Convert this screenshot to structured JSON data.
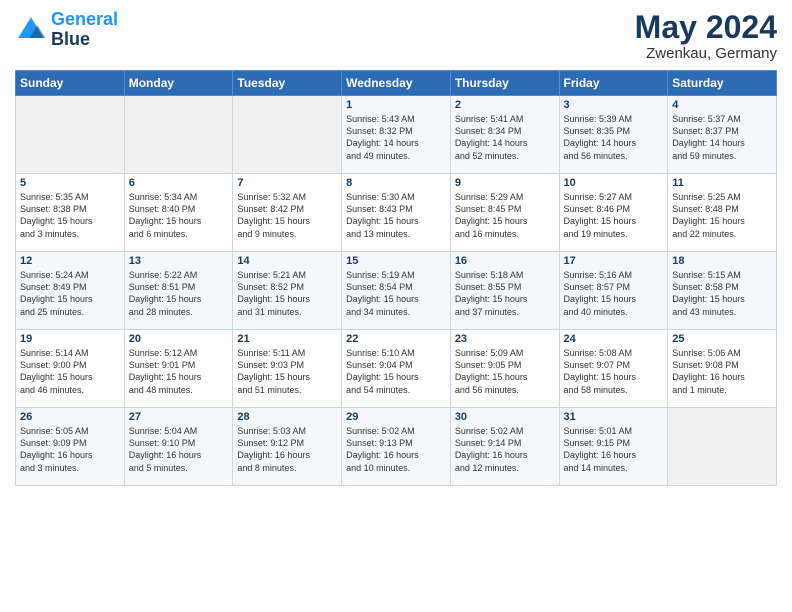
{
  "header": {
    "logo_line1": "General",
    "logo_line2": "Blue",
    "title": "May 2024",
    "subtitle": "Zwenkau, Germany"
  },
  "days_of_week": [
    "Sunday",
    "Monday",
    "Tuesday",
    "Wednesday",
    "Thursday",
    "Friday",
    "Saturday"
  ],
  "weeks": [
    [
      {
        "day": "",
        "info": ""
      },
      {
        "day": "",
        "info": ""
      },
      {
        "day": "",
        "info": ""
      },
      {
        "day": "1",
        "info": "Sunrise: 5:43 AM\nSunset: 8:32 PM\nDaylight: 14 hours\nand 49 minutes."
      },
      {
        "day": "2",
        "info": "Sunrise: 5:41 AM\nSunset: 8:34 PM\nDaylight: 14 hours\nand 52 minutes."
      },
      {
        "day": "3",
        "info": "Sunrise: 5:39 AM\nSunset: 8:35 PM\nDaylight: 14 hours\nand 56 minutes."
      },
      {
        "day": "4",
        "info": "Sunrise: 5:37 AM\nSunset: 8:37 PM\nDaylight: 14 hours\nand 59 minutes."
      }
    ],
    [
      {
        "day": "5",
        "info": "Sunrise: 5:35 AM\nSunset: 8:38 PM\nDaylight: 15 hours\nand 3 minutes."
      },
      {
        "day": "6",
        "info": "Sunrise: 5:34 AM\nSunset: 8:40 PM\nDaylight: 15 hours\nand 6 minutes."
      },
      {
        "day": "7",
        "info": "Sunrise: 5:32 AM\nSunset: 8:42 PM\nDaylight: 15 hours\nand 9 minutes."
      },
      {
        "day": "8",
        "info": "Sunrise: 5:30 AM\nSunset: 8:43 PM\nDaylight: 15 hours\nand 13 minutes."
      },
      {
        "day": "9",
        "info": "Sunrise: 5:29 AM\nSunset: 8:45 PM\nDaylight: 15 hours\nand 16 minutes."
      },
      {
        "day": "10",
        "info": "Sunrise: 5:27 AM\nSunset: 8:46 PM\nDaylight: 15 hours\nand 19 minutes."
      },
      {
        "day": "11",
        "info": "Sunrise: 5:25 AM\nSunset: 8:48 PM\nDaylight: 15 hours\nand 22 minutes."
      }
    ],
    [
      {
        "day": "12",
        "info": "Sunrise: 5:24 AM\nSunset: 8:49 PM\nDaylight: 15 hours\nand 25 minutes."
      },
      {
        "day": "13",
        "info": "Sunrise: 5:22 AM\nSunset: 8:51 PM\nDaylight: 15 hours\nand 28 minutes."
      },
      {
        "day": "14",
        "info": "Sunrise: 5:21 AM\nSunset: 8:52 PM\nDaylight: 15 hours\nand 31 minutes."
      },
      {
        "day": "15",
        "info": "Sunrise: 5:19 AM\nSunset: 8:54 PM\nDaylight: 15 hours\nand 34 minutes."
      },
      {
        "day": "16",
        "info": "Sunrise: 5:18 AM\nSunset: 8:55 PM\nDaylight: 15 hours\nand 37 minutes."
      },
      {
        "day": "17",
        "info": "Sunrise: 5:16 AM\nSunset: 8:57 PM\nDaylight: 15 hours\nand 40 minutes."
      },
      {
        "day": "18",
        "info": "Sunrise: 5:15 AM\nSunset: 8:58 PM\nDaylight: 15 hours\nand 43 minutes."
      }
    ],
    [
      {
        "day": "19",
        "info": "Sunrise: 5:14 AM\nSunset: 9:00 PM\nDaylight: 15 hours\nand 46 minutes."
      },
      {
        "day": "20",
        "info": "Sunrise: 5:12 AM\nSunset: 9:01 PM\nDaylight: 15 hours\nand 48 minutes."
      },
      {
        "day": "21",
        "info": "Sunrise: 5:11 AM\nSunset: 9:03 PM\nDaylight: 15 hours\nand 51 minutes."
      },
      {
        "day": "22",
        "info": "Sunrise: 5:10 AM\nSunset: 9:04 PM\nDaylight: 15 hours\nand 54 minutes."
      },
      {
        "day": "23",
        "info": "Sunrise: 5:09 AM\nSunset: 9:05 PM\nDaylight: 15 hours\nand 56 minutes."
      },
      {
        "day": "24",
        "info": "Sunrise: 5:08 AM\nSunset: 9:07 PM\nDaylight: 15 hours\nand 58 minutes."
      },
      {
        "day": "25",
        "info": "Sunrise: 5:06 AM\nSunset: 9:08 PM\nDaylight: 16 hours\nand 1 minute."
      }
    ],
    [
      {
        "day": "26",
        "info": "Sunrise: 5:05 AM\nSunset: 9:09 PM\nDaylight: 16 hours\nand 3 minutes."
      },
      {
        "day": "27",
        "info": "Sunrise: 5:04 AM\nSunset: 9:10 PM\nDaylight: 16 hours\nand 5 minutes."
      },
      {
        "day": "28",
        "info": "Sunrise: 5:03 AM\nSunset: 9:12 PM\nDaylight: 16 hours\nand 8 minutes."
      },
      {
        "day": "29",
        "info": "Sunrise: 5:02 AM\nSunset: 9:13 PM\nDaylight: 16 hours\nand 10 minutes."
      },
      {
        "day": "30",
        "info": "Sunrise: 5:02 AM\nSunset: 9:14 PM\nDaylight: 16 hours\nand 12 minutes."
      },
      {
        "day": "31",
        "info": "Sunrise: 5:01 AM\nSunset: 9:15 PM\nDaylight: 16 hours\nand 14 minutes."
      },
      {
        "day": "",
        "info": ""
      }
    ]
  ]
}
